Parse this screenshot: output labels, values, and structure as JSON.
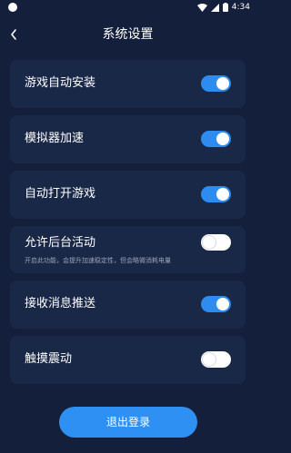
{
  "status_bar": {
    "time": "4:34"
  },
  "header": {
    "title": "系统设置"
  },
  "settings": [
    {
      "label": "游戏自动安装",
      "on": true
    },
    {
      "label": "模拟器加速",
      "on": true
    },
    {
      "label": "自动打开游戏",
      "on": true
    },
    {
      "label": "允许后台活动",
      "desc": "开启此功能，会提升加速稳定性，但会略微消耗电量",
      "on": false
    },
    {
      "label": "接收消息推送",
      "on": true
    },
    {
      "label": "触摸震动",
      "on": false
    }
  ],
  "logout_label": "退出登录",
  "colors": {
    "background": "#141f3b",
    "card": "#1a2848",
    "accent": "#2e8cf0"
  }
}
